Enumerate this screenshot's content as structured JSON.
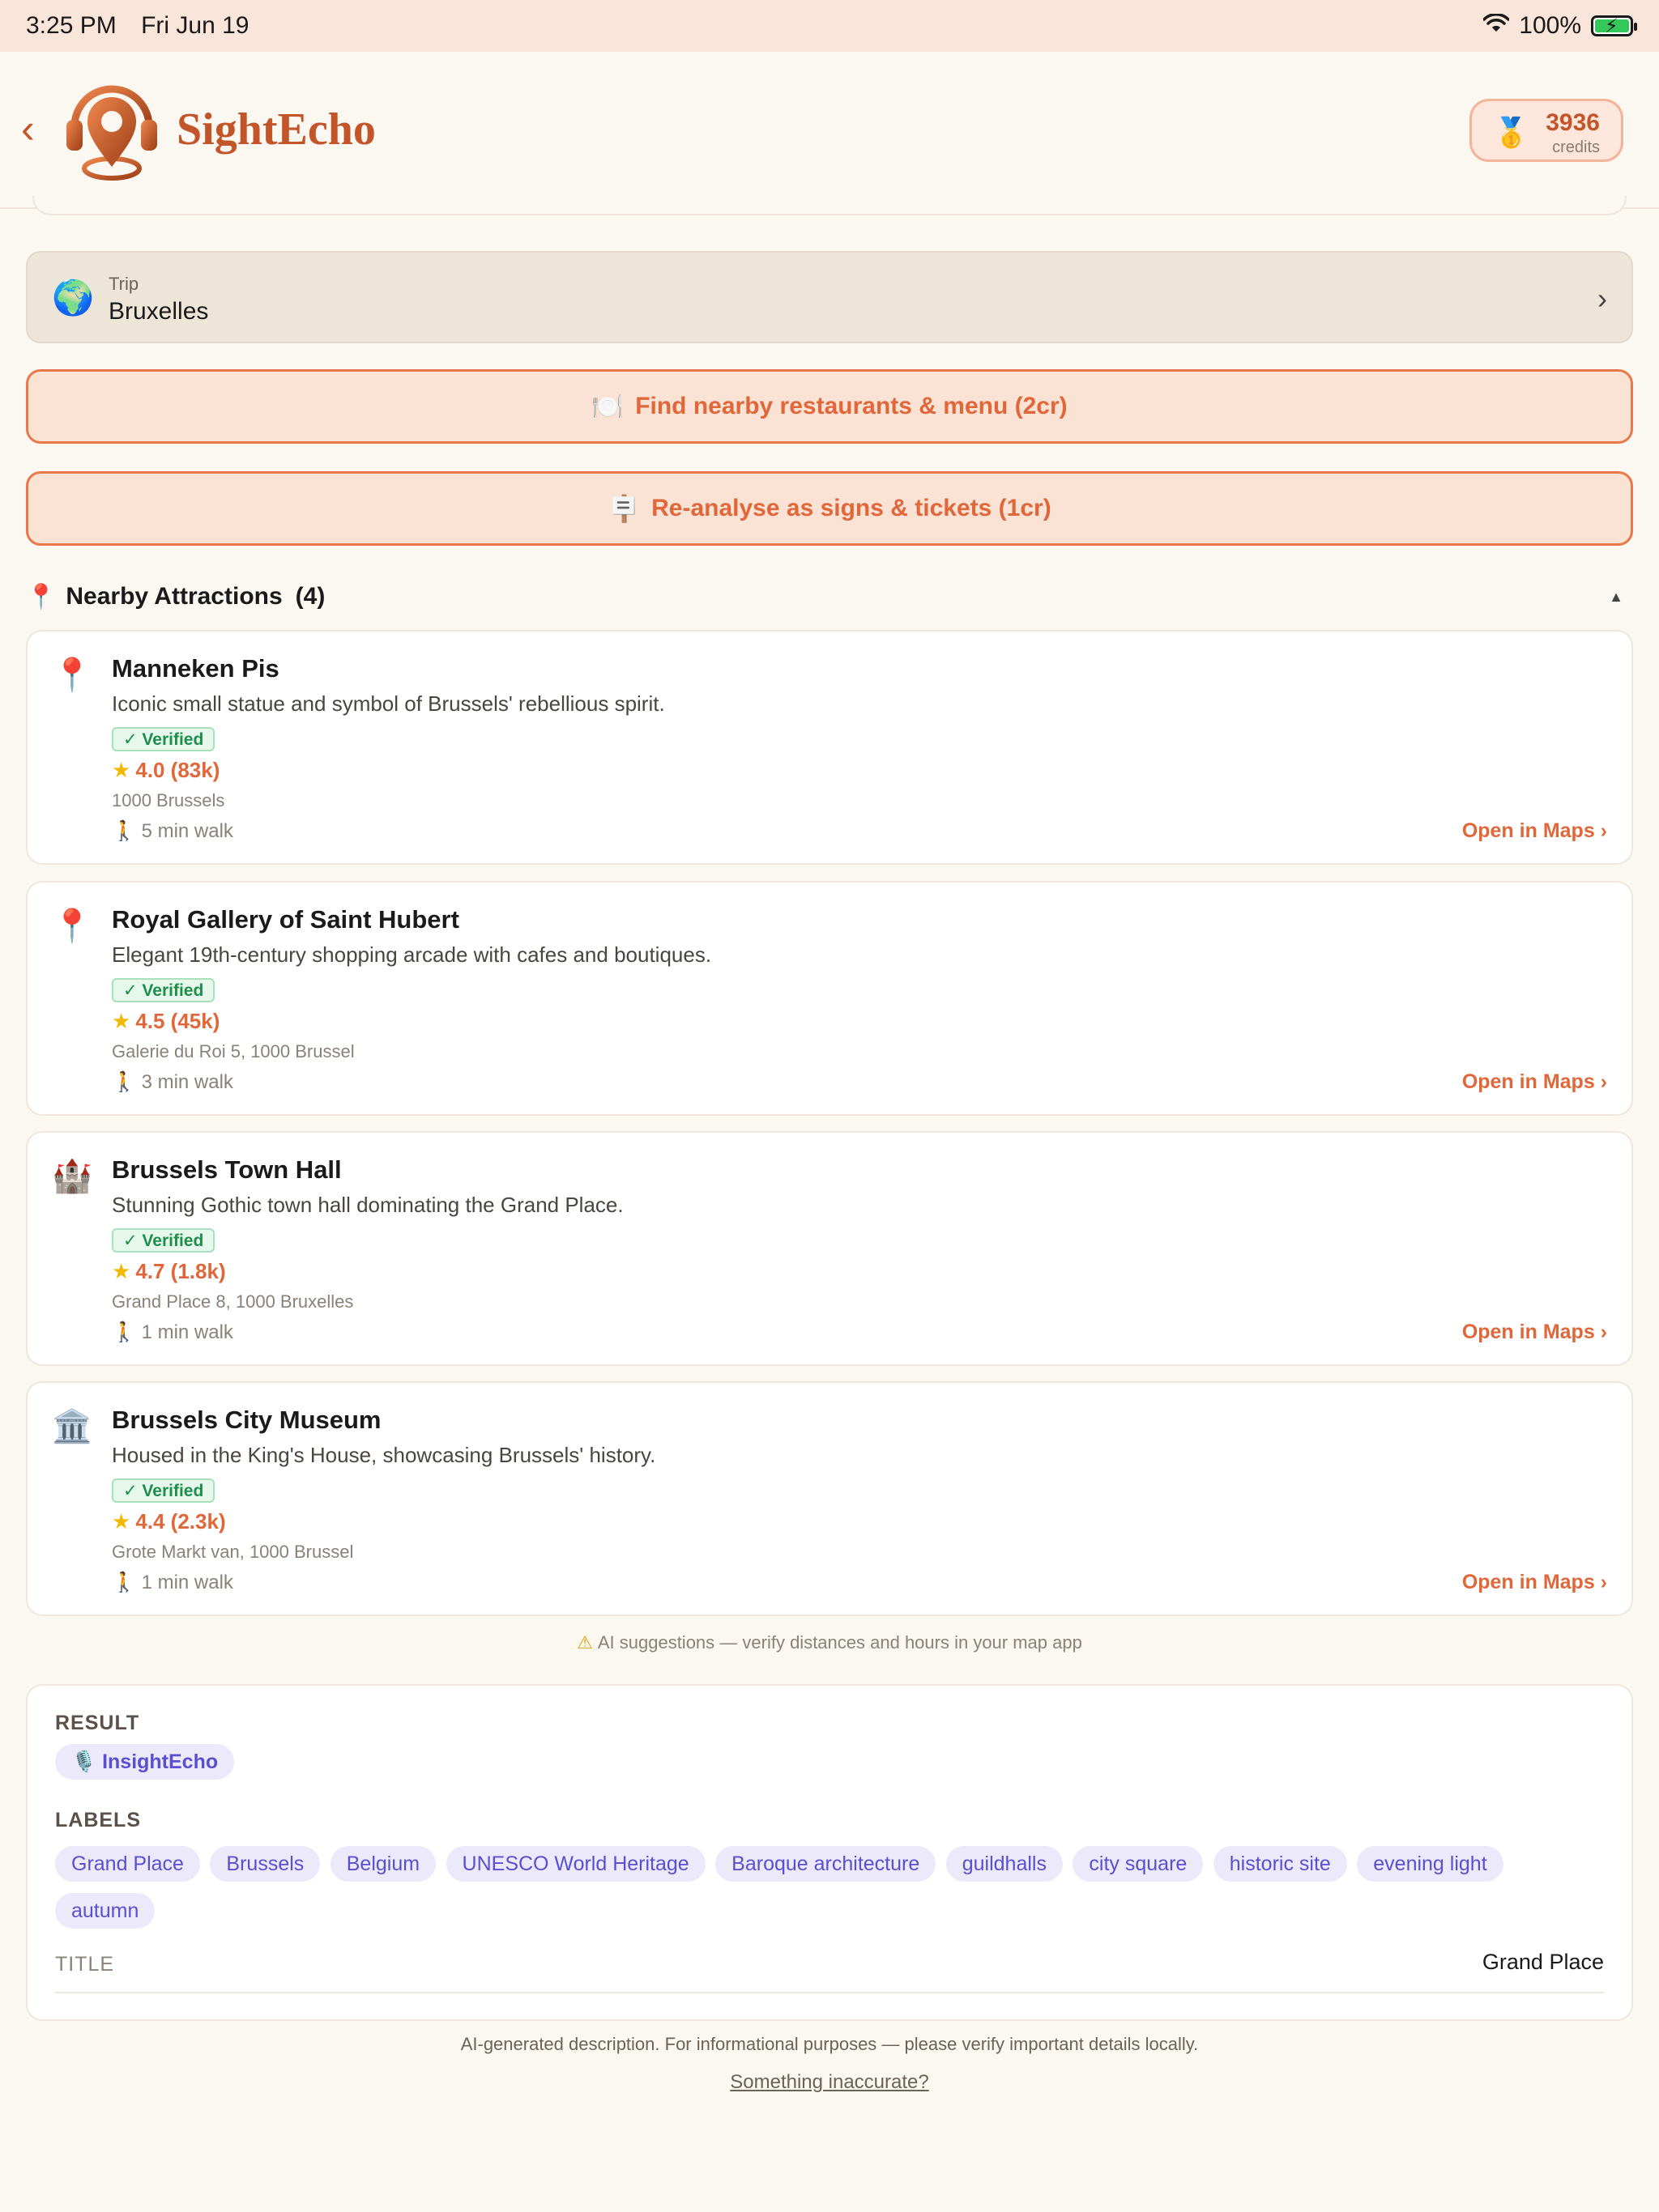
{
  "status": {
    "time": "3:25 PM",
    "date": "Fri Jun 19",
    "battery": "100%"
  },
  "header": {
    "app_name": "SightEcho",
    "credits_value": "3936",
    "credits_label": "credits"
  },
  "trip": {
    "label": "Trip",
    "value": "Bruxelles"
  },
  "actions": [
    {
      "icon": "🍽️",
      "label": "Find nearby restaurants & menu (2cr)"
    },
    {
      "icon": "🪧",
      "label": "Re-analyse as signs & tickets (1cr)"
    }
  ],
  "nearby": {
    "title": "Nearby Attractions",
    "count": "(4)",
    "items": [
      {
        "icon": "📍",
        "name": "Manneken Pis",
        "desc": "Iconic small statue and symbol of Brussels' rebellious spirit.",
        "badge": "✓ Verified",
        "rating": "4.0 (83k)",
        "address": "1000 Brussels",
        "walk": "5 min walk",
        "maps": "Open in Maps ›"
      },
      {
        "icon": "📍",
        "name": "Royal Gallery of Saint Hubert",
        "desc": "Elegant 19th-century shopping arcade with cafes and boutiques.",
        "badge": "✓ Verified",
        "rating": "4.5 (45k)",
        "address": "Galerie du Roi 5, 1000 Brussel",
        "walk": "3 min walk",
        "maps": "Open in Maps ›"
      },
      {
        "icon": "🏰",
        "name": "Brussels Town Hall",
        "desc": "Stunning Gothic town hall dominating the Grand Place.",
        "badge": "✓ Verified",
        "rating": "4.7 (1.8k)",
        "address": "Grand Place 8, 1000 Bruxelles",
        "walk": "1 min walk",
        "maps": "Open in Maps ›"
      },
      {
        "icon": "🏛️",
        "name": "Brussels City Museum",
        "desc": "Housed in the King's House, showcasing Brussels' history.",
        "badge": "✓ Verified",
        "rating": "4.4 (2.3k)",
        "address": "Grote Markt van, 1000 Brussel",
        "walk": "1 min walk",
        "maps": "Open in Maps ›"
      }
    ],
    "notice": "AI suggestions — verify distances and hours in your map app"
  },
  "result": {
    "result_heading": "RESULT",
    "result_chip": "🎙️ InsightEcho",
    "labels_heading": "LABELS",
    "labels": [
      "Grand Place",
      "Brussels",
      "Belgium",
      "UNESCO World Heritage",
      "Baroque architecture",
      "guildhalls",
      "city square",
      "historic site",
      "evening light",
      "autumn"
    ],
    "title_heading": "TITLE",
    "title_value": "Grand Place"
  },
  "footer": {
    "disclaimer": "AI-generated description. For informational purposes — please verify important details locally.",
    "report_link": "Something inaccurate?"
  },
  "colors": {
    "accent": "#e0673a",
    "brand": "#c2552a",
    "background": "#fbf7f1",
    "verified": "#1e8f4a",
    "chip": "#5a4fcf"
  }
}
